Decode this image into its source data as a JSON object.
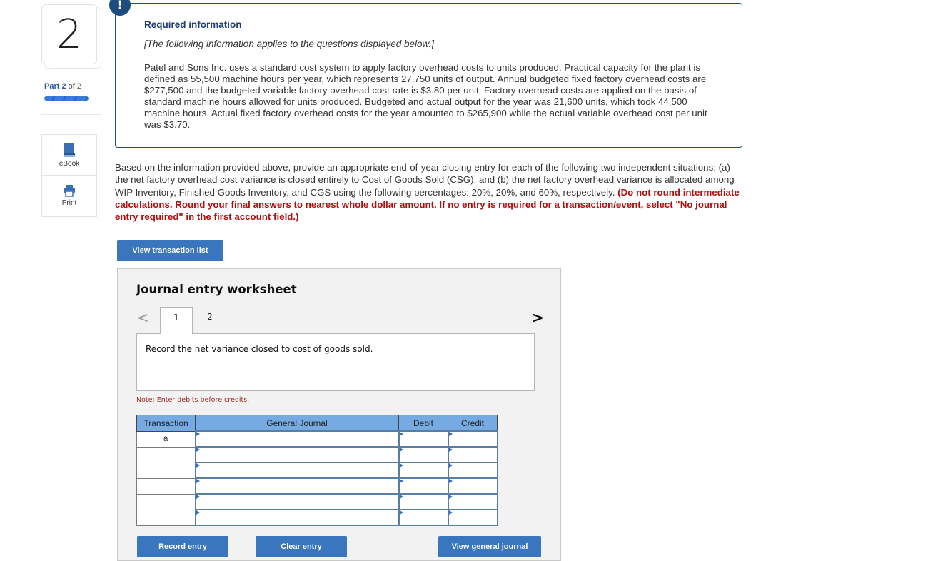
{
  "left_rail": {
    "question_number": "2",
    "part_label_prefix": "Part",
    "part_current": "2",
    "part_suffix": "of 2",
    "part_progress": 1.0,
    "tools": [
      {
        "label": "eBook",
        "icon": "book-icon"
      },
      {
        "label": "Print",
        "icon": "printer-icon"
      }
    ]
  },
  "info_box": {
    "badge": "!",
    "title": "Required information",
    "subtitle": "[The following information applies to the questions displayed below.]",
    "body": "Patel and Sons Inc. uses a standard cost system to apply factory overhead costs to units produced. Practical capacity for the plant is defined as 55,500 machine hours per year, which represents 27,750 units of output. Annual budgeted fixed factory overhead costs are $277,500 and the budgeted variable factory overhead cost rate is $3.80 per unit. Factory overhead costs are applied on the basis of standard machine hours allowed for units produced. Budgeted and actual output for the year was 21,600 units, which took 44,500 machine hours. Actual fixed factory overhead costs for the year amounted to $265,900 while the actual variable overhead cost per unit was $3.70."
  },
  "question": {
    "text": "Based on the information provided above, provide an appropriate end-of-year closing entry for each of the following two independent situations: (a) the net factory overhead cost variance is closed entirely to Cost of Goods Sold (CSG), and (b) the net factory overhead variance is allocated among WIP Inventory, Finished Goods Inventory, and CGS using the following percentages: 20%, 20%, and 60%, respectively.",
    "instruction": "(Do not round intermediate calculations. Round your final answers to nearest whole dollar amount. If no entry is required for a transaction/event, select \"No journal entry required\" in the first account field.)"
  },
  "buttons": {
    "view_transaction_list": "View transaction list",
    "record_entry": "Record entry",
    "clear_entry": "Clear entry",
    "view_general_journal": "View general journal"
  },
  "worksheet": {
    "title": "Journal entry worksheet",
    "prev_icon": "<",
    "next_icon": ">",
    "tabs": [
      "1",
      "2"
    ],
    "active_tab": "1",
    "description": "Record the net variance closed to cost of goods sold.",
    "note": "Note: Enter debits before credits.",
    "columns": [
      "Transaction",
      "General Journal",
      "Debit",
      "Credit"
    ],
    "rows": [
      {
        "transaction": "a",
        "account": "",
        "debit": "",
        "credit": ""
      },
      {
        "transaction": "",
        "account": "",
        "debit": "",
        "credit": ""
      },
      {
        "transaction": "",
        "account": "",
        "debit": "",
        "credit": ""
      },
      {
        "transaction": "",
        "account": "",
        "debit": "",
        "credit": ""
      },
      {
        "transaction": "",
        "account": "",
        "debit": "",
        "credit": ""
      },
      {
        "transaction": "",
        "account": "",
        "debit": "",
        "credit": ""
      }
    ]
  }
}
